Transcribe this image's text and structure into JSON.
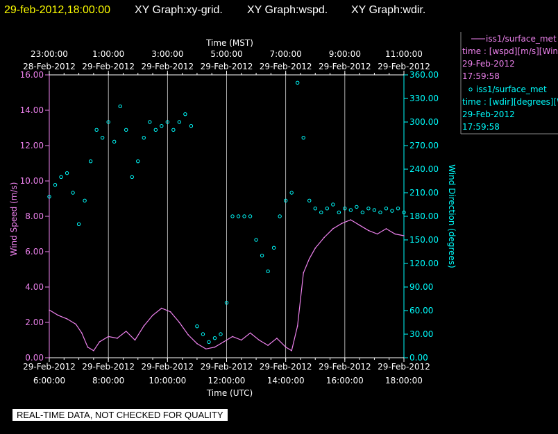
{
  "header": {
    "timestamp": "29-feb-2012,18:00:00",
    "titles": [
      "XY Graph:xy-grid.",
      "XY Graph:wspd.",
      "XY Graph:wdir."
    ]
  },
  "legend": [
    {
      "marker": "line",
      "color": "#ee82ee",
      "line1": "iss1/surface_met",
      "line2": "time : [wspd][m/s][Wind",
      "line3": "29-Feb-2012",
      "line4": "17:59:58"
    },
    {
      "marker": "circle",
      "color": "#00ffff",
      "line1": "iss1/surface_met",
      "line2": "time : [wdir][degrees][Wi",
      "line3": "29-Feb-2012",
      "line4": "17:59:58"
    }
  ],
  "footer": {
    "disclaimer": "REAL-TIME DATA, NOT CHECKED FOR QUALITY"
  },
  "chart_data": {
    "type": "line",
    "grid": true,
    "top_axis": {
      "label": "Time (MST)",
      "ticks": [
        {
          "time": "23:00:00",
          "date": "28-Feb-2012"
        },
        {
          "time": "1:00:00",
          "date": "29-Feb-2012"
        },
        {
          "time": "3:00:00",
          "date": "29-Feb-2012"
        },
        {
          "time": "5:00:00",
          "date": "29-Feb-2012"
        },
        {
          "time": "7:00:00",
          "date": "29-Feb-2012"
        },
        {
          "time": "9:00:00",
          "date": "29-Feb-2012"
        },
        {
          "time": "11:00:00",
          "date": "29-Feb-2012"
        }
      ]
    },
    "bottom_axis": {
      "label": "Time (UTC)",
      "range": [
        6.0,
        18.0
      ],
      "ticks": [
        {
          "time": "6:00:00",
          "date": "29-Feb-2012"
        },
        {
          "time": "8:00:00",
          "date": "29-Feb-2012"
        },
        {
          "time": "10:00:00",
          "date": "29-Feb-2012"
        },
        {
          "time": "12:00:00",
          "date": "29-Feb-2012"
        },
        {
          "time": "14:00:00",
          "date": "29-Feb-2012"
        },
        {
          "time": "16:00:00",
          "date": "29-Feb-2012"
        },
        {
          "time": "18:00:00",
          "date": "29-Feb-2012"
        }
      ]
    },
    "left_axis": {
      "label": "Wind Speed (m/s)",
      "range": [
        0,
        16
      ],
      "color": "#ee82ee",
      "ticks": [
        "0.00",
        "2.00",
        "4.00",
        "6.00",
        "8.00",
        "10.00",
        "12.00",
        "14.00",
        "16.00"
      ]
    },
    "right_axis": {
      "label": "Wind Direction (degrees)",
      "range": [
        0,
        360
      ],
      "color": "#00ffff",
      "ticks": [
        "0.00",
        "30.00",
        "60.00",
        "90.00",
        "120.00",
        "150.00",
        "180.00",
        "210.00",
        "240.00",
        "270.00",
        "300.00",
        "330.00",
        "360.00"
      ]
    },
    "series": [
      {
        "axis": "left",
        "color": "#ee82ee",
        "x_hours_utc": [
          6.0,
          6.3,
          6.6,
          6.9,
          7.1,
          7.3,
          7.5,
          7.7,
          8.0,
          8.3,
          8.6,
          8.9,
          9.2,
          9.5,
          9.8,
          10.1,
          10.4,
          10.7,
          11.0,
          11.3,
          11.6,
          11.9,
          12.2,
          12.5,
          12.8,
          13.1,
          13.4,
          13.7,
          14.0,
          14.2,
          14.4,
          14.6,
          14.8,
          15.0,
          15.3,
          15.6,
          15.9,
          16.2,
          16.5,
          16.8,
          17.1,
          17.4,
          17.7,
          18.0
        ],
        "values": [
          2.7,
          2.4,
          2.2,
          1.9,
          1.4,
          0.6,
          0.4,
          0.9,
          1.2,
          1.1,
          1.5,
          1.0,
          1.8,
          2.4,
          2.8,
          2.6,
          2.0,
          1.3,
          0.8,
          0.5,
          0.6,
          0.9,
          1.2,
          1.0,
          1.4,
          1.0,
          0.7,
          1.1,
          0.6,
          0.4,
          1.8,
          4.8,
          5.6,
          6.2,
          6.8,
          7.3,
          7.6,
          7.8,
          7.5,
          7.2,
          7.0,
          7.3,
          7.0,
          6.9
        ]
      },
      {
        "axis": "right",
        "color": "#00ffff",
        "x_hours_utc": [
          6.0,
          6.2,
          6.4,
          6.6,
          6.8,
          7.0,
          7.2,
          7.4,
          7.6,
          7.8,
          8.0,
          8.2,
          8.4,
          8.6,
          8.8,
          9.0,
          9.2,
          9.4,
          9.6,
          9.8,
          10.0,
          10.2,
          10.4,
          10.6,
          10.8,
          11.0,
          11.2,
          11.4,
          11.6,
          11.8,
          12.0,
          12.2,
          12.4,
          12.6,
          12.8,
          13.0,
          13.2,
          13.4,
          13.6,
          13.8,
          14.0,
          14.2,
          14.4,
          14.6,
          14.8,
          15.0,
          15.2,
          15.4,
          15.6,
          15.8,
          16.0,
          16.2,
          16.4,
          16.6,
          16.8,
          17.0,
          17.2,
          17.4,
          17.6,
          17.8,
          18.0
        ],
        "values": [
          205,
          220,
          230,
          235,
          210,
          170,
          200,
          250,
          290,
          280,
          300,
          275,
          320,
          290,
          230,
          250,
          280,
          300,
          290,
          295,
          300,
          290,
          300,
          310,
          295,
          40,
          30,
          20,
          25,
          30,
          70,
          180,
          180,
          180,
          180,
          150,
          130,
          110,
          140,
          180,
          200,
          210,
          350,
          280,
          200,
          190,
          185,
          190,
          195,
          185,
          190,
          188,
          192,
          185,
          190,
          188,
          185,
          190,
          187,
          190,
          185
        ]
      }
    ]
  }
}
